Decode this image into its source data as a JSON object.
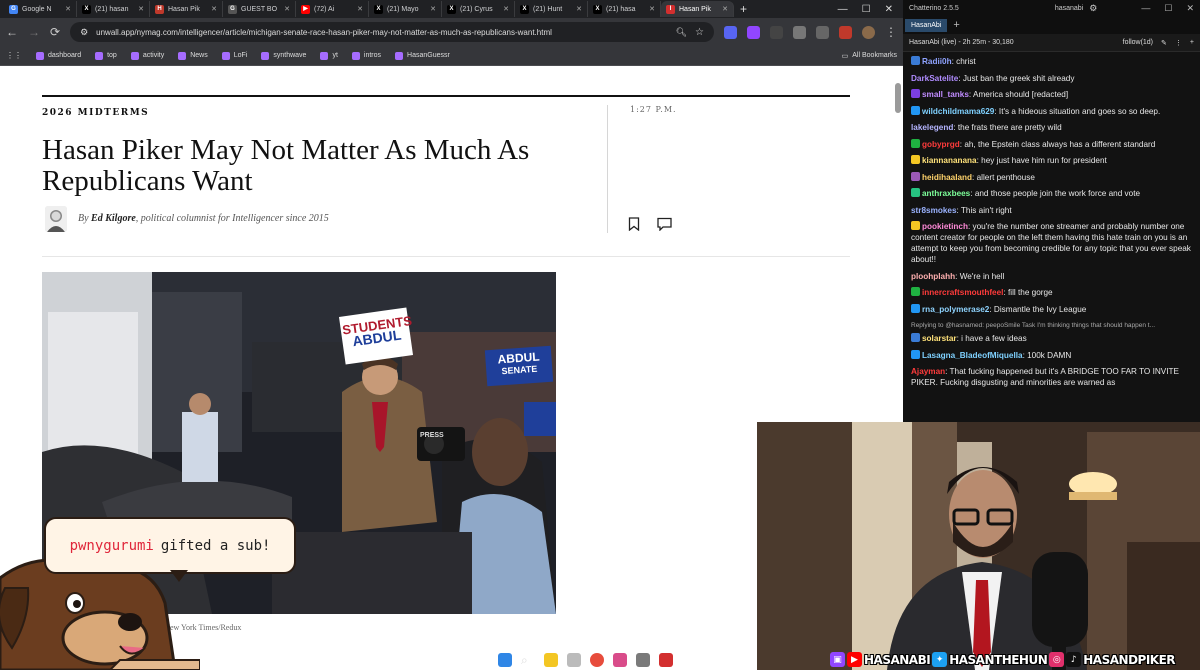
{
  "browser": {
    "tabs": [
      {
        "label": "Google N",
        "fav": "G",
        "color": "#4285f4"
      },
      {
        "label": "(21) hasan",
        "fav": "X",
        "color": "#000000"
      },
      {
        "label": "Hasan Pik",
        "fav": "H",
        "color": "#c0392b"
      },
      {
        "label": "GUEST BO",
        "fav": "G",
        "color": "#555555"
      },
      {
        "label": "(72) Ai",
        "fav": "▶",
        "color": "#ff0000"
      },
      {
        "label": "(21) Mayo",
        "fav": "X",
        "color": "#000000"
      },
      {
        "label": "(21) Cyrus",
        "fav": "X",
        "color": "#000000"
      },
      {
        "label": "(21) Hunt",
        "fav": "X",
        "color": "#000000"
      },
      {
        "label": "(21) hasa",
        "fav": "X",
        "color": "#000000"
      },
      {
        "label": "Hasan Pik",
        "fav": "I",
        "color": "#d32f2f"
      }
    ],
    "url": "unwall.app/nymag.com/intelligencer/article/michigan-senate-race-hasan-piker-may-not-matter-as-much-as-republicans-want.html",
    "bookmarks": [
      "dashboard",
      "top",
      "activity",
      "News",
      "LoFi",
      "synthwave",
      "yt",
      "intros",
      "HasanGuessr"
    ],
    "all_bookmarks": "All Bookmarks"
  },
  "article": {
    "rubric": "2026 MIDTERMS",
    "time": "1:27 P.M.",
    "headline": "Hasan Piker May Not Matter As Much As Republicans Want",
    "byline_prefix": "By ",
    "author": "Ed Kilgore",
    "byline_suffix": ", political columnist for Intelligencer since 2015",
    "credit": "va/The New York Times/Redux",
    "sign_top": "STUDENTS",
    "sign_top2": "ABDUL",
    "sign_right": "ABDUL",
    "sign_right2": "SENATE",
    "sign_press": "PRESS"
  },
  "chatterino": {
    "title": "Chatterino 2.5.5",
    "account": "hasanabi",
    "tab": "HasanAbi",
    "split_header": "HasanAbi (live) - 2h 25m - 30,180",
    "follow": "follow(1d)",
    "messages": [
      {
        "user": "Radii0h",
        "color": "#8fa3ff",
        "text": "christ",
        "badge": "#3a7bd5"
      },
      {
        "user": "DarkSatelite",
        "color": "#b08cff",
        "text": "Just ban the greek shit already",
        "badge": ""
      },
      {
        "user": "small_tanks",
        "color": "#c08cff",
        "text": "America should [redacted]",
        "badge": "#7b3fe4"
      },
      {
        "user": "wildchildmama629",
        "color": "#7fd1ff",
        "text": "It's a hideous situation and goes so so deep.",
        "badge": "#2196f3"
      },
      {
        "user": "lakelegend",
        "color": "#b5b5ff",
        "text": "the frats there are pretty wild",
        "badge": ""
      },
      {
        "user": "gobyprgd",
        "color": "#ff3b3b",
        "text": "ah, the Epstein class always has a different standard",
        "badge": "#1fb141"
      },
      {
        "user": "kiannananana",
        "color": "#ffe27a",
        "text": "hey just have him run for president",
        "badge": "#f3c623"
      },
      {
        "user": "heidihaaland",
        "color": "#ffd36b",
        "text": "allert penthouse",
        "badge": "#9b59b6"
      },
      {
        "user": "anthraxbees",
        "color": "#7dff9a",
        "text": "and those people join the work force and vote",
        "badge": "#26c281"
      },
      {
        "user": "str8smokes",
        "color": "#9bb3ff",
        "text": "This ain't right",
        "badge": ""
      },
      {
        "user": "pookietinch",
        "color": "#ff8ad8",
        "text": "you're the number one streamer and probably number one content creator for people on the left them having this hate train on you is an attempt to keep you from becoming credible for any topic that you ever speak about!!",
        "badge": "#f3c623"
      },
      {
        "user": "ploohplahh",
        "color": "#ffb0b0",
        "text": "We're in hell",
        "badge": ""
      },
      {
        "user": "innercraftsmouthfeel",
        "color": "#ff3b3b",
        "text": "fill the gorge",
        "badge": "#1fb141"
      },
      {
        "user": "rna_polymerase2",
        "color": "#8fd4ff",
        "text": "Dismantle the Ivy League",
        "badge": "#2196f3"
      },
      {
        "user": "solarstar",
        "color": "#ffe27a",
        "text": "i have a few ideas",
        "badge": "#3a7bd5"
      },
      {
        "user": "Lasagna_BladeofMiquella",
        "color": "#7fd1ff",
        "text": "100k DAMN",
        "badge": "#2196f3"
      },
      {
        "user": "Ajayman",
        "color": "#ff3b3b",
        "text": "That fucking happened but it's A BRIDGE TOO FAR TO INVITE PIKER. Fucking disgusting and minorities are warned as",
        "badge": ""
      }
    ],
    "reply_text": "Replying to @hasnamed: peepoSmile Task I'm thinking things that should happen t..."
  },
  "alert": {
    "name": "pwnygurumi",
    "text": "gifted a sub!"
  },
  "socials": {
    "twitch": "HASANABI",
    "twitter": "HASANTHEHUN",
    "instagram": "HASANDPIKER"
  },
  "colors": {
    "twitch": "#9146ff",
    "youtube": "#ff0000",
    "twitter": "#1da1f2",
    "instagram": "#e1306c",
    "tiktok": "#000000"
  }
}
